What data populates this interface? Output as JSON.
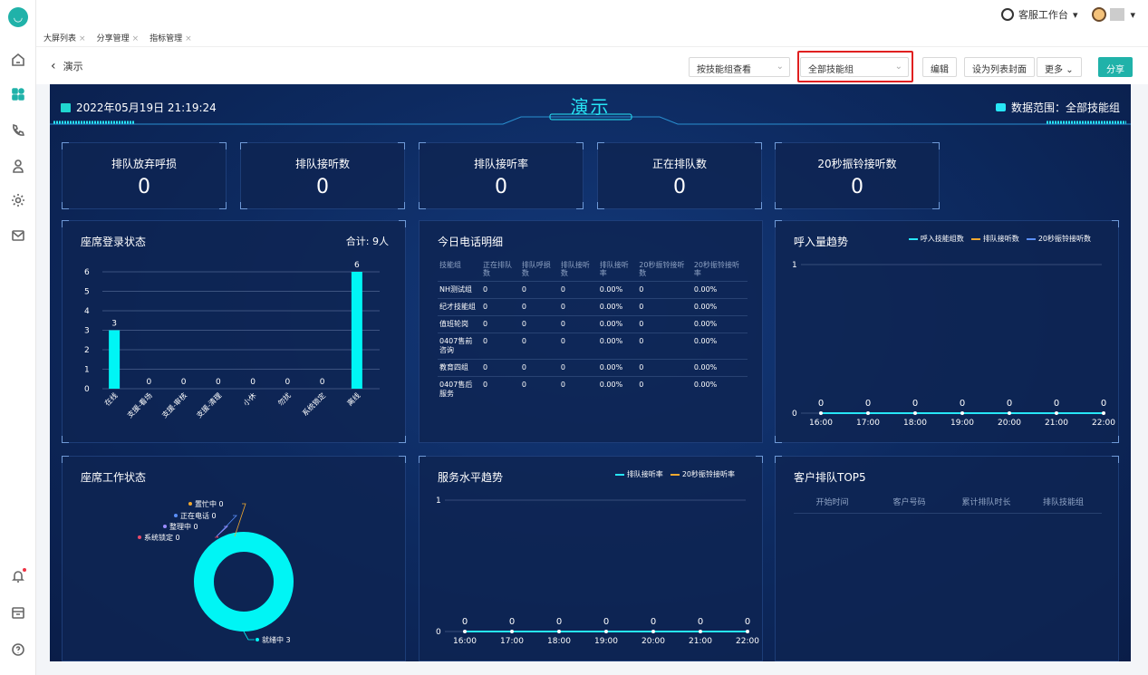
{
  "topbar": {
    "workspace_label": "客服工作台",
    "workspace_caret": "▾",
    "avatar_caret": "▾"
  },
  "tabs": [
    {
      "label": "大屏列表"
    },
    {
      "label": "分享管理"
    },
    {
      "label": "指标管理"
    }
  ],
  "toolbar": {
    "back_label": "演示",
    "view_by": "按技能组查看",
    "skill_group": "全部技能组",
    "edit_label": "编辑",
    "cover_label": "设为列表封面",
    "more_label": "更多",
    "share_label": "分享"
  },
  "screen": {
    "datetime": "2022年05月19日 21:19:24",
    "title": "演示",
    "range_label": "数据范围：全部技能组"
  },
  "kpis": [
    {
      "label": "排队放弃呼损",
      "value": "0"
    },
    {
      "label": "排队接听数",
      "value": "0"
    },
    {
      "label": "排队接听率",
      "value": "0"
    },
    {
      "label": "正在排队数",
      "value": "0"
    },
    {
      "label": "20秒振铃接听数",
      "value": "0"
    }
  ],
  "agent_login": {
    "title": "座席登录状态",
    "total": "合计: 9人"
  },
  "calls": {
    "title": "今日电话明细",
    "headers": [
      "技能组",
      "正在排队数",
      "排队呼损数",
      "排队接听数",
      "排队接听率",
      "20秒振铃接听数",
      "20秒振铃接听率"
    ],
    "rows": [
      [
        "NH测试组",
        "0",
        "0",
        "0",
        "0.00%",
        "0",
        "0.00%"
      ],
      [
        "纪才技能组",
        "0",
        "0",
        "0",
        "0.00%",
        "0",
        "0.00%"
      ],
      [
        "值班轮岗",
        "0",
        "0",
        "0",
        "0.00%",
        "0",
        "0.00%"
      ],
      [
        "0407售前咨询",
        "0",
        "0",
        "0",
        "0.00%",
        "0",
        "0.00%"
      ],
      [
        "教育四组",
        "0",
        "0",
        "0",
        "0.00%",
        "0",
        "0.00%"
      ],
      [
        "0407售后服务",
        "0",
        "0",
        "0",
        "0.00%",
        "0",
        "0.00%"
      ]
    ]
  },
  "inbound": {
    "title": "呼入量趋势"
  },
  "work_status": {
    "title": "座席工作状态"
  },
  "service": {
    "title": "服务水平趋势"
  },
  "top5": {
    "title": "客户排队TOP5",
    "headers": [
      "开始时间",
      "客户号码",
      "累计排队时长",
      "排队技能组"
    ]
  },
  "colors": {
    "accent": "#20b2a9",
    "cyan": "#00f5f5",
    "series_orange": "#f0a830",
    "series_blue": "#5b8ff9",
    "series_cyan": "#27e6f6"
  },
  "chart_data": [
    {
      "type": "bar",
      "title": "座席登录状态",
      "categories": [
        "在线",
        "支援-看场",
        "支援-审核",
        "支援-清理",
        "小休",
        "勿扰",
        "系统锁定",
        "离线"
      ],
      "values": [
        3,
        0,
        0,
        0,
        0,
        0,
        0,
        6
      ],
      "ylim": [
        0,
        6
      ],
      "yticks": [
        0,
        1,
        2,
        3,
        4,
        5,
        6
      ],
      "grid": true
    },
    {
      "type": "line",
      "title": "呼入量趋势",
      "x": [
        "16:00",
        "17:00",
        "18:00",
        "19:00",
        "20:00",
        "21:00",
        "22:00"
      ],
      "series": [
        {
          "name": "呼入技能组数",
          "values": [
            0,
            0,
            0,
            0,
            0,
            0,
            0
          ]
        },
        {
          "name": "排队接听数",
          "values": [
            0,
            0,
            0,
            0,
            0,
            0,
            0
          ]
        },
        {
          "name": "20秒振铃接听数",
          "values": [
            0,
            0,
            0,
            0,
            0,
            0,
            0
          ]
        }
      ],
      "ylim": [
        0,
        1
      ],
      "yticks": [
        0,
        1
      ],
      "legend": "top-right"
    },
    {
      "type": "pie",
      "title": "座席工作状态",
      "slices": [
        {
          "label": "置忙中",
          "value": 0
        },
        {
          "label": "正在电话",
          "value": 0
        },
        {
          "label": "整理中",
          "value": 0
        },
        {
          "label": "系统锁定",
          "value": 0
        },
        {
          "label": "就绪中",
          "value": 3
        }
      ]
    },
    {
      "type": "line",
      "title": "服务水平趋势",
      "x": [
        "16:00",
        "17:00",
        "18:00",
        "19:00",
        "20:00",
        "21:00",
        "22:00"
      ],
      "series": [
        {
          "name": "排队接听率",
          "values": [
            0,
            0,
            0,
            0,
            0,
            0,
            0
          ]
        },
        {
          "name": "20秒振铃接听率",
          "values": [
            0,
            0,
            0,
            0,
            0,
            0,
            0
          ]
        }
      ],
      "ylim": [
        0,
        1
      ],
      "yticks": [
        0,
        1
      ],
      "legend": "top-right"
    }
  ]
}
